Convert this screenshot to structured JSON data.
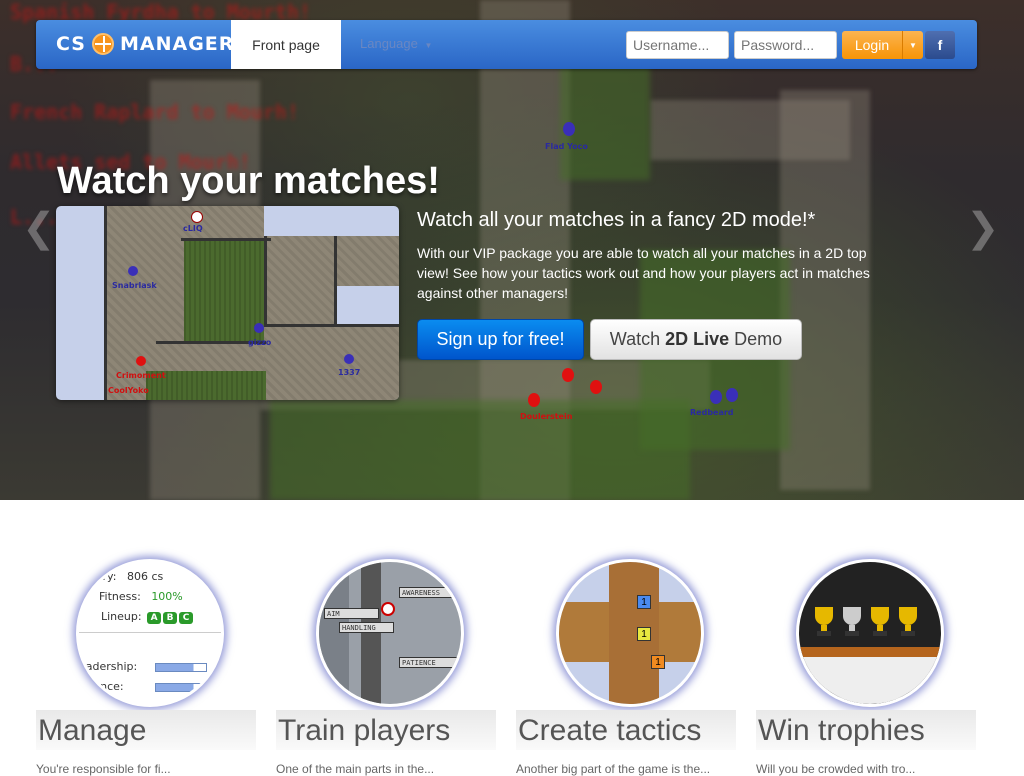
{
  "nav": {
    "brand_left": "CS",
    "brand_right": "MANAGER",
    "front_page": "Front page",
    "language": "Language",
    "username_placeholder": "Username...",
    "password_placeholder": "Password...",
    "login": "Login",
    "facebook": "f"
  },
  "hero": {
    "title": "Watch your matches!",
    "subtitle": "Watch all your matches in a fancy 2D mode!*",
    "description": "With our VIP package you are able to watch all your matches in a 2D top view! See how your tactics work out and how your players act in matches against other managers!",
    "signup_button": "Sign up for free!",
    "demo_prefix": "Watch",
    "demo_bold": "2D Live",
    "demo_suffix": "Demo",
    "background_lines": [
      "Spanish Fyrdha to Mourth!",
      "B...",
      "French Raplard to Mourh!",
      "Allets sed to Mourh!",
      "L..."
    ],
    "preview_players": [
      {
        "name": "cLIQ",
        "team": "white"
      },
      {
        "name": "Snabrlask",
        "team": "blue"
      },
      {
        "name": "gizzo",
        "team": "blue"
      },
      {
        "name": "1337",
        "team": "blue"
      },
      {
        "name": "Crimoment",
        "team": "red"
      },
      {
        "name": "CoolYoko",
        "team": "red"
      }
    ],
    "bg_players": [
      {
        "name": "Flad Yoco",
        "team": "blue"
      },
      {
        "name": "Doulerstein",
        "team": "red"
      },
      {
        "name": "Redbeard",
        "team": "blue"
      }
    ]
  },
  "features": [
    {
      "title": "Manage",
      "desc": "You're responsible for fi..."
    },
    {
      "title": "Train players",
      "desc": "One of the main parts in the..."
    },
    {
      "title": "Create tactics",
      "desc": "Another big part of the game is the..."
    },
    {
      "title": "Win trophies",
      "desc": "Will you be crowded with tro..."
    }
  ],
  "manage_card": {
    "salary_label": "Salary:",
    "salary_value": "806 cs",
    "fitness_label": "Fitness:",
    "fitness_value": "100%",
    "lineup_label": "Lineup:",
    "lineup_badges": [
      "A",
      "B",
      "C"
    ],
    "leadership_label": "eadership:",
    "experience_label": "erience:"
  },
  "train_card": {
    "bars": [
      "AWARENESS",
      "AIM",
      "HANDLING",
      "PATIENCE"
    ]
  },
  "tactics_card": {
    "tiles": [
      "1",
      "1",
      "1"
    ]
  },
  "colors": {
    "navbar": "#2a66c6",
    "login": "#f89406",
    "signup": "#0055cc",
    "fitness": "#2a9a2a"
  }
}
